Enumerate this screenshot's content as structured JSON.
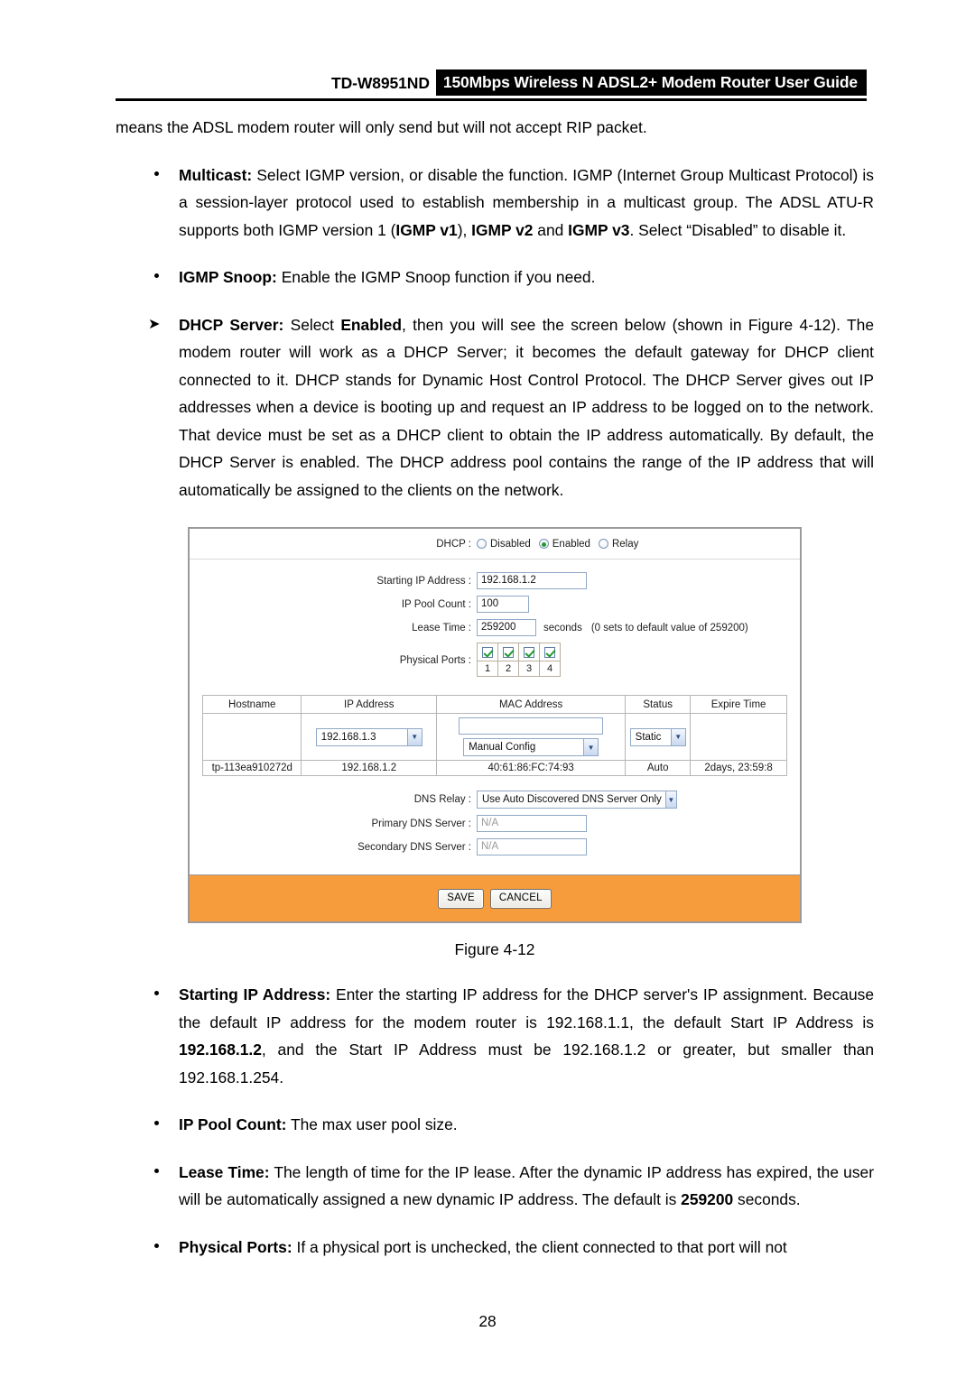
{
  "header": {
    "model": "TD-W8951ND",
    "title": "150Mbps Wireless N ADSL2+ Modem Router User Guide"
  },
  "body": {
    "intro_line": "means the ADSL modem router will only send but will not accept RIP packet.",
    "multicast": {
      "term": "Multicast:",
      "text_1": " Select IGMP version, or disable the function. IGMP (Internet Group Multicast Protocol) is a session-layer protocol used to establish membership in a multicast group. The ADSL ATU-R supports both IGMP version 1 (",
      "bold_1": "IGMP v1",
      "text_2": "), ",
      "bold_2": "IGMP v2",
      "text_3": " and ",
      "bold_3": "IGMP v3",
      "text_4": ". Select “Disabled” to disable it."
    },
    "igmp_snoop": {
      "term": "IGMP Snoop:",
      "text": " Enable the IGMP Snoop function if you need."
    },
    "dhcp_server": {
      "term": "DHCP Server:",
      "text_1": " Select ",
      "bold_1": "Enabled",
      "text_2": ", then you will see the screen below (shown in Figure 4-12). The modem router will work as a DHCP Server; it becomes the default gateway for DHCP client connected to it. DHCP stands for Dynamic Host Control Protocol. The DHCP Server gives out IP addresses when a device is booting up and request an IP address to be logged on to the network. That device must be set as a DHCP client to obtain the IP address automatically. By default, the DHCP Server is enabled. The DHCP address pool contains the range of the IP address that will automatically be assigned to the clients on the network."
    },
    "starting_ip": {
      "term": "Starting IP Address:",
      "text_1": " Enter the starting IP address for the DHCP server's IP assignment. Because the default IP address for the modem router is 192.168.1.1, the default Start IP Address is ",
      "bold_1": "192.168.1.2",
      "text_2": ", and the Start IP Address must be 192.168.1.2 or greater, but smaller than 192.168.1.254."
    },
    "ip_pool_count": {
      "term": "IP Pool Count:",
      "text": " The max user pool size."
    },
    "lease_time": {
      "term": "Lease Time:",
      "text_1": " The length of time for the IP lease. After the dynamic IP address has expired, the user will be automatically assigned a new dynamic IP address. The default is ",
      "bold_1": "259200",
      "text_2": " seconds."
    },
    "physical_ports": {
      "term": "Physical Ports:",
      "text": " If a physical port is unchecked, the client connected to that port will not"
    }
  },
  "figure": {
    "caption": "Figure 4-12",
    "accent_orange": "#f79c3c",
    "dhcp": {
      "label": "DHCP :",
      "options": [
        {
          "label": "Disabled",
          "selected": false
        },
        {
          "label": "Enabled",
          "selected": true
        },
        {
          "label": "Relay",
          "selected": false
        }
      ]
    },
    "fields": {
      "starting_ip_label": "Starting IP Address :",
      "starting_ip_value": "192.168.1.2",
      "ip_pool_label": "IP Pool Count :",
      "ip_pool_value": "100",
      "lease_time_label": "Lease Time :",
      "lease_time_value": "259200",
      "lease_unit": "seconds",
      "lease_note": "(0 sets to default value of 259200)",
      "physical_ports_label": "Physical Ports :",
      "ports": [
        {
          "number": "1",
          "checked": true
        },
        {
          "number": "2",
          "checked": true
        },
        {
          "number": "3",
          "checked": true
        },
        {
          "number": "4",
          "checked": true
        }
      ]
    },
    "clients_table": {
      "columns": [
        "Hostname",
        "IP Address",
        "MAC Address",
        "Status",
        "Expire Time"
      ],
      "edit_row": {
        "hostname": "",
        "ip_select_value": "192.168.1.3",
        "mac_input_value": "",
        "mac_mode_select_value": "Manual Config",
        "status_select_value": "Static",
        "expire_time": ""
      },
      "rows": [
        {
          "hostname": "tp-113ea910272d",
          "ip_address": "192.168.1.2",
          "mac_address": "40:61:86:FC:74:93",
          "status": "Auto",
          "expire_time": "2days, 23:59:8"
        }
      ]
    },
    "dns": {
      "relay_label": "DNS Relay :",
      "relay_value": "Use Auto Discovered DNS Server Only",
      "primary_label": "Primary DNS Server :",
      "primary_value": "N/A",
      "secondary_label": "Secondary DNS Server :",
      "secondary_value": "N/A"
    },
    "actions": {
      "save": "SAVE",
      "cancel": "CANCEL"
    }
  },
  "footer": {
    "page_number": "28"
  }
}
